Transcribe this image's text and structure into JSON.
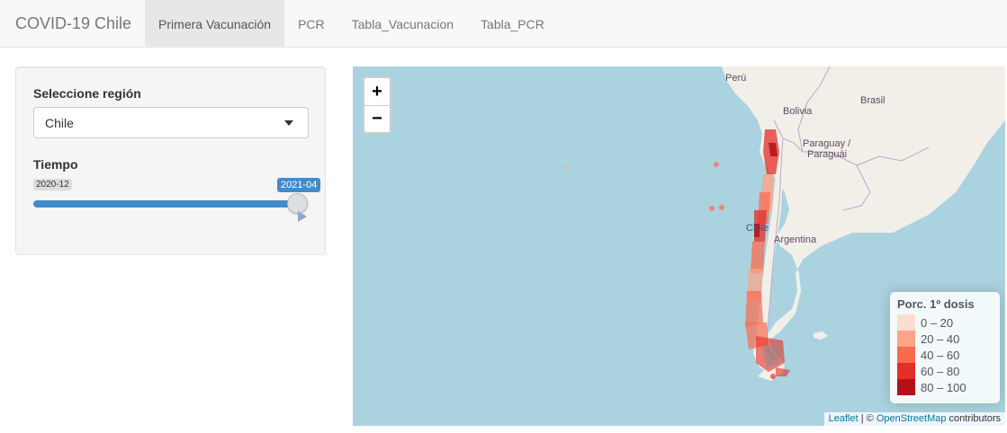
{
  "navbar": {
    "brand": "COVID-19 Chile",
    "tabs": [
      {
        "label": "Primera Vacunación",
        "active": true
      },
      {
        "label": "PCR",
        "active": false
      },
      {
        "label": "Tabla_Vacunacion",
        "active": false
      },
      {
        "label": "Tabla_PCR",
        "active": false
      }
    ]
  },
  "sidebar": {
    "region_label": "Seleccione región",
    "region_value": "Chile",
    "time_label": "Tiempo",
    "slider_min": "2020-12",
    "slider_max": "2021-04",
    "slider_position_percent": 100
  },
  "map": {
    "zoom_in": "+",
    "zoom_out": "−",
    "country_labels": {
      "peru": "Perú",
      "bolivia": "Bolivia",
      "brasil": "Brasil",
      "paraguay1": "Paraguay /",
      "paraguay2": "Paraguái",
      "chile": "Chile",
      "argentina": "Argentina"
    },
    "legend": {
      "title": "Porc. 1º dosis",
      "items": [
        {
          "label": "0 – 20",
          "color": "#fdddd1"
        },
        {
          "label": "20 – 40",
          "color": "#fca487"
        },
        {
          "label": "40 – 60",
          "color": "#f96b4f"
        },
        {
          "label": "60 – 80",
          "color": "#e32f27"
        },
        {
          "label": "80 – 100",
          "color": "#b3101b"
        }
      ]
    },
    "attribution": {
      "leaflet": "Leaflet",
      "sep": " | © ",
      "osm": "OpenStreetMap",
      "suffix": " contributors"
    },
    "colors": {
      "water": "#aad3df",
      "land": "#f2efe9",
      "border": "#b8a8c8"
    }
  }
}
